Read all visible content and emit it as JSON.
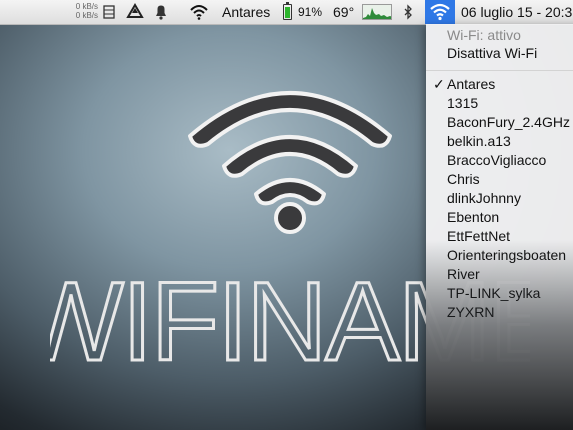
{
  "menubar": {
    "net_up": "0 kB/s",
    "net_down": "0 kB/s",
    "active_network": "Antares",
    "battery_percent": "91%",
    "battery_level": 0.91,
    "temperature": "69°",
    "datetime": "06 luglio 15 - 20:3",
    "icons": [
      "drive-icon",
      "storage-icon",
      "bell-icon",
      "wifi-icon",
      "battery-icon",
      "activity-graph-icon",
      "bluetooth-icon",
      "wifi-menu-icon"
    ]
  },
  "wifi_menu": {
    "status": "Wi-Fi: attivo",
    "toggle_label": "Disattiva Wi-Fi",
    "networks": [
      {
        "name": "Antares",
        "connected": true
      },
      {
        "name": "1315"
      },
      {
        "name": "BaconFury_2.4GHz"
      },
      {
        "name": "belkin.a13"
      },
      {
        "name": "BraccoVigliacco"
      },
      {
        "name": "Chris"
      },
      {
        "name": "dlinkJohnny"
      },
      {
        "name": "Ebenton"
      },
      {
        "name": "EttFettNet"
      },
      {
        "name": "Orienteringsboaten"
      },
      {
        "name": "River"
      },
      {
        "name": "TP-LINK_sylka"
      },
      {
        "name": "ZYXRN"
      }
    ]
  },
  "hero": {
    "title": "WIFINAME"
  },
  "colors": {
    "accent": "#2f78e6",
    "battery_green": "#2db52d"
  }
}
